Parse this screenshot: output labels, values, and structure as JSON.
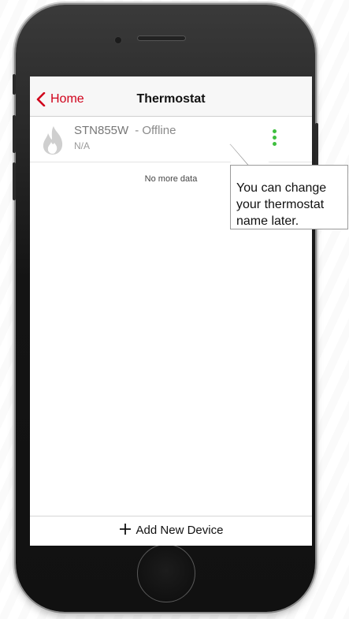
{
  "navbar": {
    "back_label": "Home",
    "title": "Thermostat",
    "back_icon": "chevron-left-icon",
    "accent_color": "#d0021b"
  },
  "device": {
    "name": "STN855W",
    "status": "- Offline",
    "subtitle": "N/A",
    "icon": "flame-icon",
    "menu_icon": "more-vertical-icon",
    "menu_color": "#3fbf3f"
  },
  "list_footer": "No more data",
  "tooltip": {
    "text": "You can change your thermostat name later."
  },
  "bottom": {
    "add_label": "Add New Device",
    "add_icon": "plus-icon"
  }
}
